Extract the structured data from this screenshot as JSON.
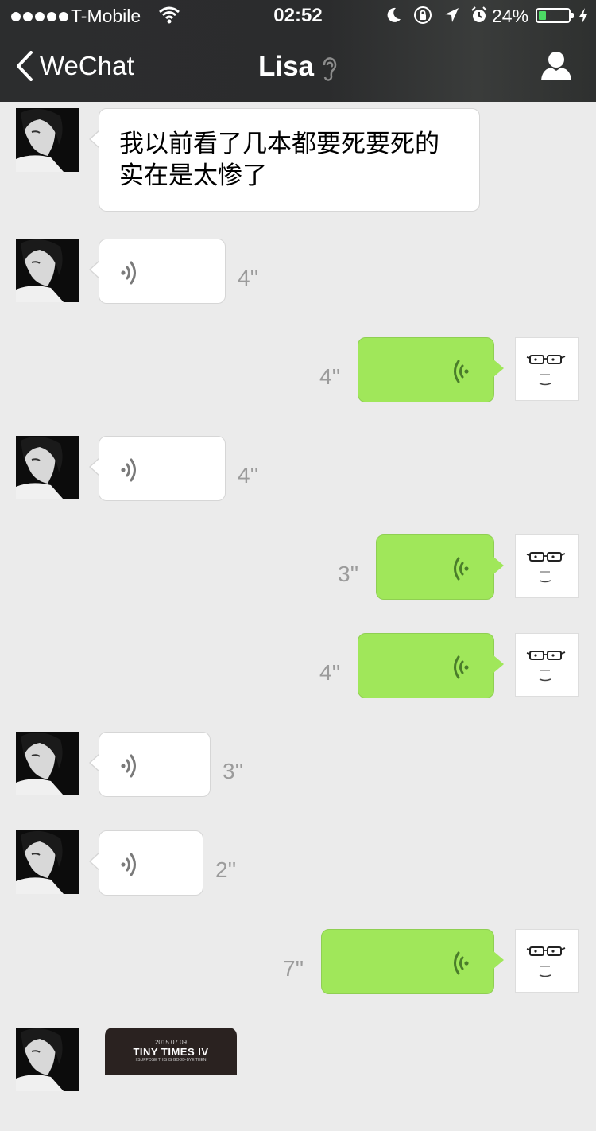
{
  "status_bar": {
    "carrier": "T-Mobile",
    "time": "02:52",
    "battery_percent": "24%",
    "battery_level": 0.24,
    "signal_dots": 5,
    "battery_fill_color": "#4cd964"
  },
  "nav": {
    "back_label": "WeChat",
    "title": "Lisa",
    "back_icon": "chevron-left-icon",
    "title_icon": "ear-icon",
    "right_icon": "user-profile-icon"
  },
  "colors": {
    "chat_background": "#ebebeb",
    "outgoing_bubble": "#a0e75a",
    "incoming_bubble": "#ffffff",
    "header": "#2c2d2e"
  },
  "messages": [
    {
      "sender": "Lisa",
      "type": "text",
      "lines": [
        "我以前看了几本都要死要死的",
        "实在是太惨了"
      ]
    },
    {
      "sender": "Lisa",
      "type": "voice",
      "duration": "4''"
    },
    {
      "sender": "me",
      "type": "voice",
      "duration": "4''"
    },
    {
      "sender": "Lisa",
      "type": "voice",
      "duration": "4''"
    },
    {
      "sender": "me",
      "type": "voice",
      "duration": "3''"
    },
    {
      "sender": "me",
      "type": "voice",
      "duration": "4''"
    },
    {
      "sender": "Lisa",
      "type": "voice",
      "duration": "3''"
    },
    {
      "sender": "Lisa",
      "type": "voice",
      "duration": "2''"
    },
    {
      "sender": "me",
      "type": "voice",
      "duration": "7''"
    },
    {
      "sender": "Lisa",
      "type": "link-card",
      "card": {
        "date": "2015.07.09",
        "title": "TINY TIMES IV",
        "subtitle": "I SUPPOSE THIS IS GOOD-BYE THEN"
      }
    }
  ]
}
